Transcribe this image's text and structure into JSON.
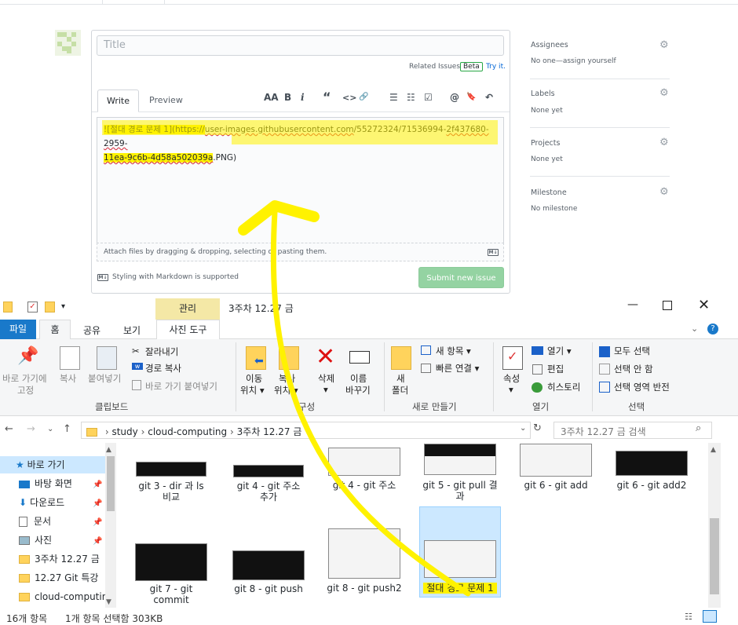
{
  "github": {
    "title_placeholder": "Title",
    "related_issues": "Related Issues",
    "beta": "Beta",
    "try_it": "Try it.",
    "tab_write": "Write",
    "tab_preview": "Preview",
    "textarea_line1_a": "![절대 경로 문제 1](https://",
    "textarea_line1_b": "user-images.githubusercontent.com",
    "textarea_line1_c": "/55272324/71536994-",
    "textarea_line1_d": "2f437680-2959-",
    "textarea_line2_a": "11ea-9c6b-4d58a502039a",
    "textarea_line2_b": ".PNG)",
    "attach_text": "Attach files by dragging & dropping, selecting or pasting them.",
    "markdown_note": "Styling with Markdown is supported",
    "submit": "Submit new issue",
    "md_badge": "M↓",
    "sidebar": {
      "assignees": "Assignees",
      "assignees_value": "No one—assign yourself",
      "labels": "Labels",
      "labels_value": "None yet",
      "projects": "Projects",
      "projects_value": "None yet",
      "milestone": "Milestone",
      "milestone_value": "No milestone"
    },
    "toolbar": [
      "AA",
      "B",
      "i",
      "“",
      "<>",
      "🔗",
      "☰",
      "☷",
      "☑",
      "@",
      "🔖",
      "↶"
    ]
  },
  "explorer": {
    "context_tab": "관리",
    "window_title": "3주차 12.27 금",
    "tabs": {
      "file": "파일",
      "home": "홈",
      "share": "공유",
      "view": "보기",
      "picture_tools": "사진 도구"
    },
    "ribbon": {
      "pin": [
        "바로 가기에",
        "고정"
      ],
      "copy": "복사",
      "paste": "붙여넣기",
      "cut": "잘라내기",
      "copy_path": "경로 복사",
      "paste_shortcut": "바로 가기 붙여넣기",
      "move_to": [
        "이동",
        "위치 ▾"
      ],
      "copy_to": [
        "복사",
        "위치 ▾"
      ],
      "delete": [
        "삭제",
        "▾"
      ],
      "rename": [
        "이름",
        "바꾸기"
      ],
      "new_folder": [
        "새",
        "폴더"
      ],
      "new_item": "새 항목 ▾",
      "easy_access": "빠른 연결 ▾",
      "properties": [
        "속성",
        "▾"
      ],
      "open": "열기 ▾",
      "edit": "편집",
      "history": "히스토리",
      "select_all": "모두 선택",
      "select_none": "선택 안 함",
      "invert": "선택 영역 반전",
      "groups": [
        "클립보드",
        "구성",
        "새로 만들기",
        "열기",
        "선택"
      ]
    },
    "breadcrumb": [
      "study",
      "cloud-computing",
      "3주차 12.27 금"
    ],
    "search_placeholder": "3주차 12.27 금 검색",
    "nav": {
      "quick_access": "바로 가기",
      "desktop": "바탕 화면",
      "downloads": "다운로드",
      "documents": "문서",
      "pictures": "사진",
      "f1": "3주차 12.27 금",
      "f2": "12.27 Git 특강",
      "f3": "cloud-computin"
    },
    "files": [
      [
        "git 3 - dir 과 ls",
        "비교"
      ],
      [
        "git 4 - git 주소",
        "추가"
      ],
      [
        "git 4 - git 주소",
        ""
      ],
      [
        "git 5 - git pull 결",
        "과"
      ],
      [
        "git 6 - git add",
        ""
      ],
      [
        "git 6 - git add2",
        ""
      ],
      [
        "git 7 - git",
        "commit"
      ],
      [
        "git 8 - git push",
        ""
      ],
      [
        "git 8 - git push2",
        ""
      ],
      [
        "절대 경로 문제 1",
        ""
      ]
    ],
    "status_count": "16개 항목",
    "status_selected": "1개 항목 선택함 303KB"
  }
}
